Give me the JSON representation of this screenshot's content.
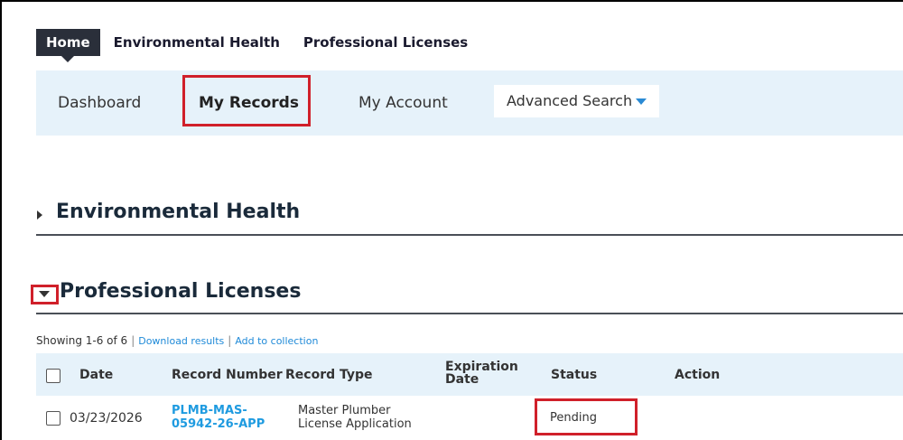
{
  "top_tabs": [
    "Home",
    "Environmental Health",
    "Professional Licenses"
  ],
  "subnav": {
    "dashboard": "Dashboard",
    "my_records": "My Records",
    "my_account": "My Account",
    "advanced_search": "Advanced Search"
  },
  "sections": {
    "environmental_health": "Environmental Health",
    "professional_licenses": "Professional Licenses"
  },
  "results": {
    "showing": "Showing 1-6 of 6",
    "separator": "|",
    "download": "Download results",
    "add_to_collection": "Add to collection"
  },
  "table": {
    "headers": {
      "date": "Date",
      "record_number": "Record Number",
      "record_type": "Record Type",
      "expiration_date_line1": "Expiration",
      "expiration_date_line2": "Date",
      "status": "Status",
      "action": "Action"
    },
    "rows": [
      {
        "date": "03/23/2026",
        "record_number_line1": "PLMB-MAS-",
        "record_number_line2": "05942-26-APP",
        "record_type_line1": "Master Plumber",
        "record_type_line2": "License Application",
        "expiration_date": "",
        "status": "Pending",
        "action": ""
      }
    ]
  },
  "colors": {
    "highlight": "#d0202a",
    "link": "#1f9be0",
    "nav_bg": "#e6f2fa",
    "active_tab": "#2a2f3a"
  }
}
